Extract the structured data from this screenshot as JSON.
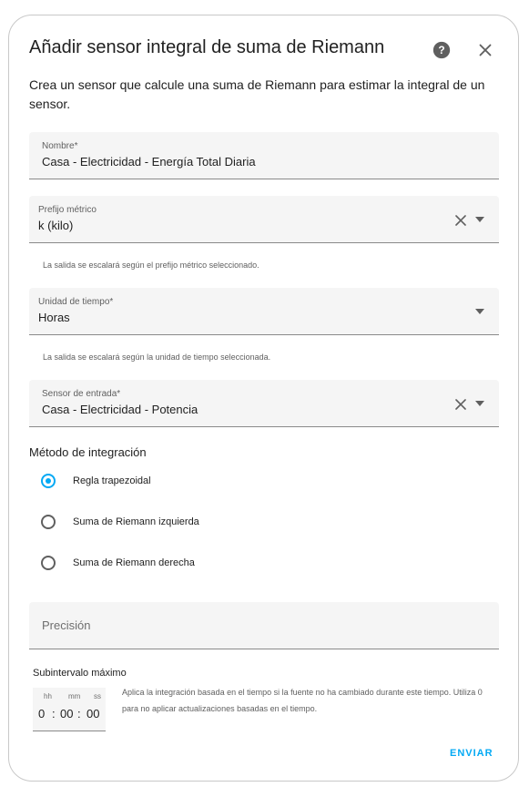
{
  "dialog": {
    "title": "Añadir sensor integral de suma de Riemann",
    "description": "Crea un sensor que calcule una suma de Riemann para estimar la integral de un sensor."
  },
  "fields": {
    "name": {
      "label": "Nombre*",
      "value": "Casa - Electricidad - Energía Total Diaria"
    },
    "metric_prefix": {
      "label": "Prefijo métrico",
      "value": "k (kilo)",
      "helper": "La salida se escalará según el prefijo métrico seleccionado."
    },
    "time_unit": {
      "label": "Unidad de tiempo*",
      "value": "Horas",
      "helper": "La salida se escalará según la unidad de tiempo seleccionada."
    },
    "input_sensor": {
      "label": "Sensor de entrada*",
      "value": "Casa - Electricidad - Potencia"
    }
  },
  "integration": {
    "label": "Método de integración",
    "options": [
      {
        "label": "Regla trapezoidal",
        "checked": true
      },
      {
        "label": "Suma de Riemann izquierda",
        "checked": false
      },
      {
        "label": "Suma de Riemann derecha",
        "checked": false
      }
    ]
  },
  "precision": {
    "placeholder": "Precisión"
  },
  "max_subinterval": {
    "label": "Subintervalo máximo",
    "units": {
      "hours": "hh",
      "minutes": "mm",
      "seconds": "ss"
    },
    "values": {
      "hours": "0",
      "minutes": "00",
      "seconds": "00"
    },
    "separator": ":",
    "description": "Aplica la integración basada en el tiempo si la fuente no ha cambiado durante este tiempo. Utiliza 0 para no aplicar actualizaciones basadas en el tiempo."
  },
  "actions": {
    "submit": "ENVIAR"
  },
  "icons": {
    "help": "help-circle-icon",
    "close": "close-icon",
    "clear": "clear-icon",
    "dropdown": "chevron-down-icon"
  },
  "colors": {
    "accent": "#03a9f4",
    "field_bg": "#f5f5f5",
    "text": "#212121"
  }
}
